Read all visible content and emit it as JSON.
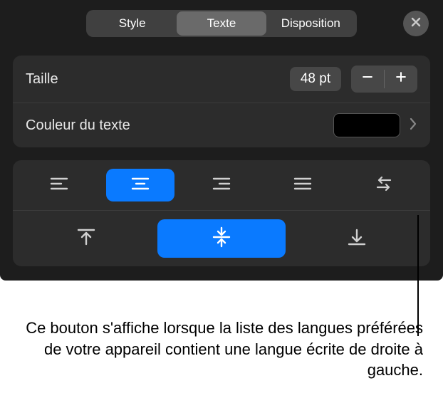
{
  "header": {
    "tabs": {
      "style": "Style",
      "text": "Texte",
      "layout": "Disposition"
    }
  },
  "size": {
    "label": "Taille",
    "value": "48 pt"
  },
  "color": {
    "label": "Couleur du texte",
    "swatch": "#000000"
  },
  "caption": "Ce bouton s'affiche lorsque la liste des langues préférées de votre appareil contient une langue écrite de droite à gauche."
}
